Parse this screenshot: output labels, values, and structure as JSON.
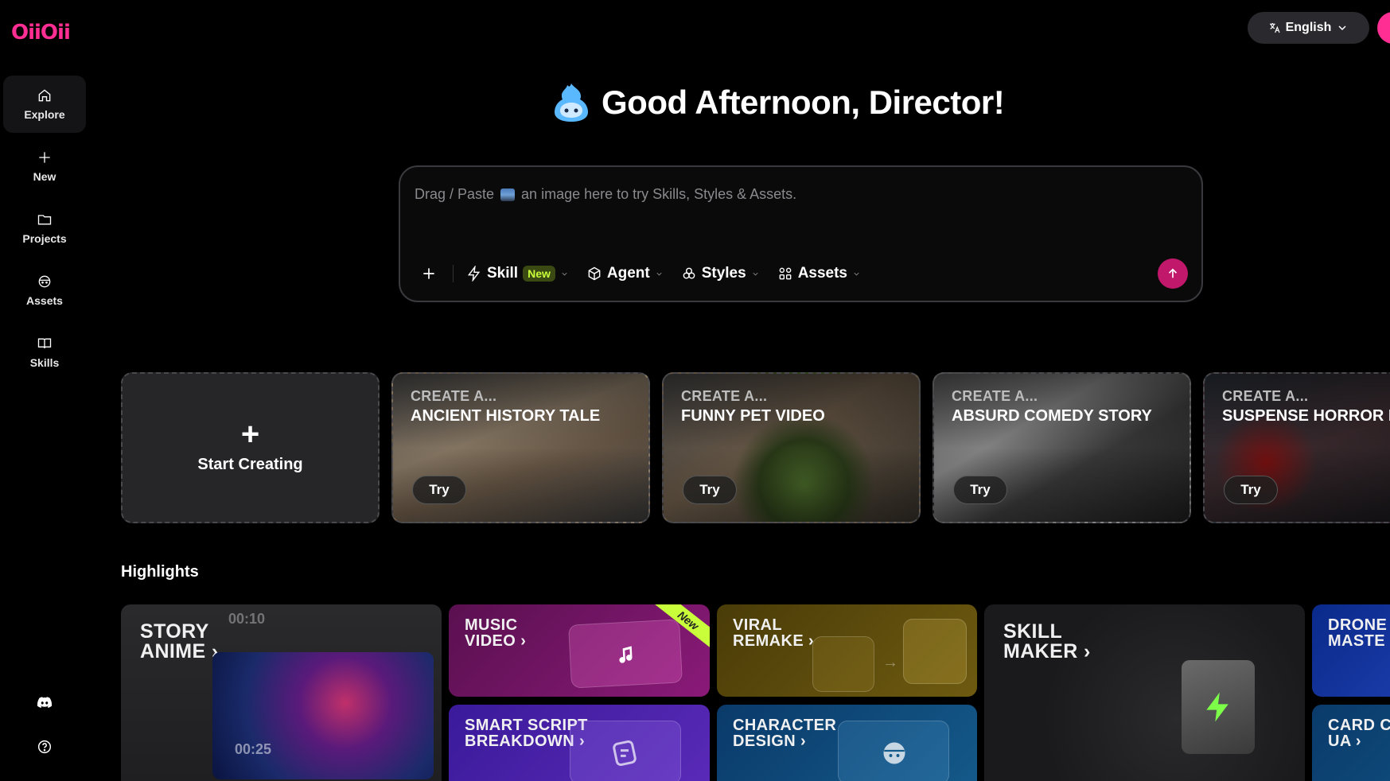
{
  "brand": {
    "logo_text": "OiiOii",
    "accent": "#ff2e93"
  },
  "sidebar": {
    "items": [
      {
        "label": "Explore",
        "icon": "home-icon",
        "active": true
      },
      {
        "label": "New",
        "icon": "plus-icon"
      },
      {
        "label": "Projects",
        "icon": "folder-icon"
      },
      {
        "label": "Assets",
        "icon": "face-icon"
      },
      {
        "label": "Skills",
        "icon": "book-icon"
      }
    ],
    "bottom": [
      {
        "icon": "discord-icon"
      },
      {
        "icon": "help-icon"
      }
    ]
  },
  "header": {
    "language": "English"
  },
  "greeting": {
    "text": "Good Afternoon, Director!"
  },
  "prompt": {
    "placeholder_before": "Drag / Paste",
    "placeholder_after": "an image here to try Skills, Styles & Assets.",
    "toolbar": {
      "skill": "Skill",
      "skill_badge": "New",
      "agent": "Agent",
      "styles": "Styles",
      "assets": "Assets"
    }
  },
  "templates": {
    "start_label": "Start Creating",
    "prefix": "CREATE A...",
    "try_label": "Try",
    "cards": [
      {
        "title": "ANCIENT HISTORY TALE"
      },
      {
        "title": "FUNNY PET VIDEO"
      },
      {
        "title": "ABSURD COMEDY STORY"
      },
      {
        "title": "SUSPENSE HORROR F"
      }
    ]
  },
  "highlights": {
    "title": "Highlights",
    "tiles": {
      "story": {
        "line1": "STORY",
        "line2": "ANIME ›",
        "time1": "00:10",
        "time2": "00:25"
      },
      "music": {
        "line1": "MUSIC",
        "line2": "VIDEO ›",
        "badge": "New"
      },
      "viral": {
        "line1": "VIRAL",
        "line2": "REMAKE ›"
      },
      "skill": {
        "line1": "SKILL",
        "line2": "MAKER ›"
      },
      "drone": {
        "line1": "DRONE",
        "line2": "MASTE"
      },
      "script": {
        "line1": "SMART SCRIPT",
        "line2": "BREAKDOWN ›"
      },
      "character": {
        "line1": "CHARACTER",
        "line2": "DESIGN ›"
      },
      "card": {
        "line1": "CARD C",
        "line2": "UA ›"
      }
    }
  }
}
